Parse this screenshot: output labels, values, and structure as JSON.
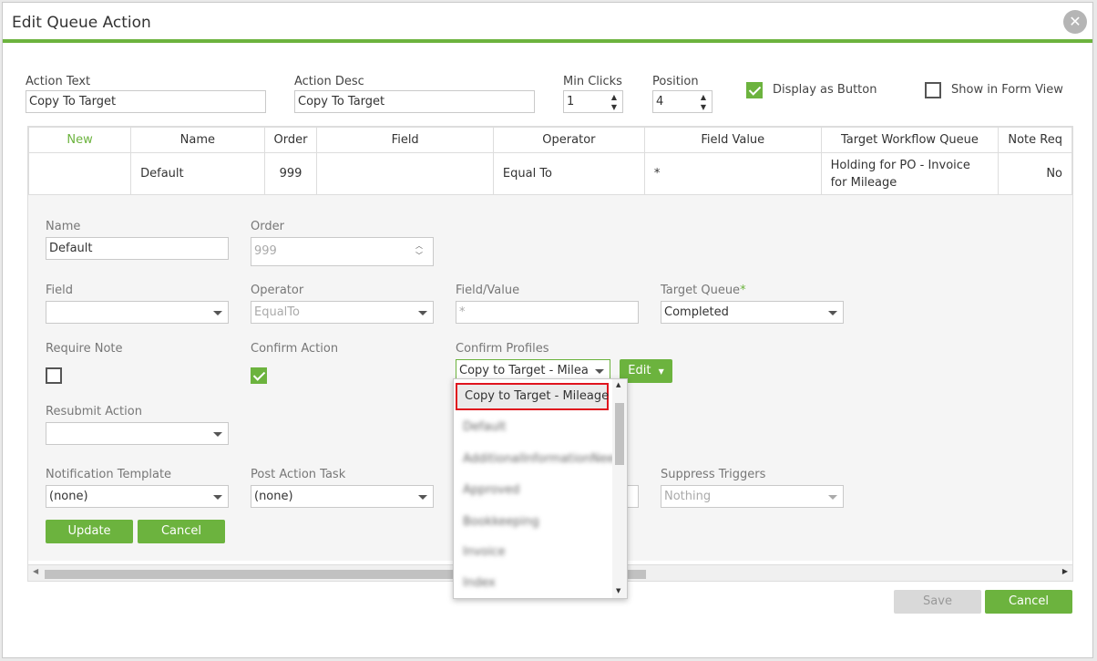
{
  "dialog": {
    "title": "Edit Queue Action"
  },
  "top_form": {
    "action_text": {
      "label": "Action Text",
      "value": "Copy To Target"
    },
    "action_desc": {
      "label": "Action Desc",
      "value": "Copy To Target"
    },
    "min_clicks": {
      "label": "Min Clicks",
      "value": "1"
    },
    "position": {
      "label": "Position",
      "value": "4"
    },
    "display_as_button": {
      "label": "Display as Button",
      "checked": true
    },
    "show_in_form_view": {
      "label": "Show in Form View",
      "checked": false
    }
  },
  "grid": {
    "columns": [
      "New",
      "Name",
      "Order",
      "Field",
      "Operator",
      "Field Value",
      "Target Workflow Queue",
      "Note Req"
    ],
    "row": {
      "name": "Default",
      "order": "999",
      "field": "",
      "operator": "Equal To",
      "field_value": "*",
      "target_queue": "Holding for PO - Invoice for Mileage",
      "note_req": "No"
    }
  },
  "edit_form": {
    "name": {
      "label": "Name",
      "value": "Default"
    },
    "order": {
      "label": "Order",
      "value": "999"
    },
    "field": {
      "label": "Field",
      "value": ""
    },
    "operator": {
      "label": "Operator",
      "value": "EqualTo"
    },
    "field_value": {
      "label": "Field/Value",
      "placeholder": "*"
    },
    "target_queue": {
      "label": "Target Queue",
      "required_mark": "*",
      "value": "Completed"
    },
    "require_note": {
      "label": "Require Note",
      "checked": false
    },
    "confirm_action": {
      "label": "Confirm Action",
      "checked": true
    },
    "confirm_profiles": {
      "label": "Confirm Profiles",
      "value": "Copy to Target - Mileage",
      "edit_label": "Edit"
    },
    "resubmit_action": {
      "label": "Resubmit Action",
      "value": ""
    },
    "notification_template": {
      "label": "Notification Template",
      "value": "(none)"
    },
    "post_action_task": {
      "label": "Post Action Task",
      "value": "(none)"
    },
    "suppress_triggers": {
      "label": "Suppress Triggers",
      "value": "Nothing"
    },
    "update_label": "Update",
    "cancel_label": "Cancel"
  },
  "dropdown": {
    "highlighted": "Copy to Target - Mileage",
    "blurred_items": [
      "Default",
      "AdditionalInformationNeeded",
      "Approved",
      "Bookkeeping",
      "Invoice",
      "Index"
    ]
  },
  "footer": {
    "save_label": "Save",
    "cancel_label": "Cancel"
  },
  "colors": {
    "accent": "#6cb33e",
    "highlight_border": "#e0141e"
  }
}
